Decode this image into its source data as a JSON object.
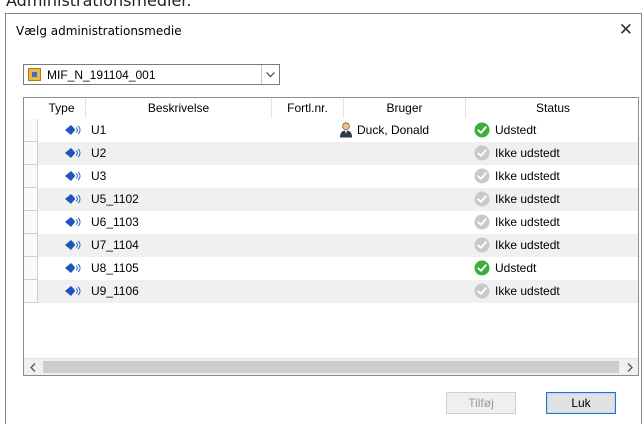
{
  "page_cut_title": "Administrationsmedier.",
  "dialog": {
    "title": "Vælg administrationsmedie",
    "close_label": "✕"
  },
  "combo": {
    "selected": "MIF_N_191104_001"
  },
  "table": {
    "headers": {
      "type": "Type",
      "desc": "Beskrivelse",
      "fortl": "Fortl.nr.",
      "bruger": "Bruger",
      "status": "Status"
    },
    "rows": [
      {
        "desc": "U1",
        "fortl": "",
        "bruger": "Duck, Donald",
        "status": "Udstedt"
      },
      {
        "desc": "U2",
        "fortl": "",
        "bruger": "",
        "status": "Ikke udstedt"
      },
      {
        "desc": "U3",
        "fortl": "",
        "bruger": "",
        "status": "Ikke udstedt"
      },
      {
        "desc": "U5_1102",
        "fortl": "",
        "bruger": "",
        "status": "Ikke udstedt"
      },
      {
        "desc": "U6_1103",
        "fortl": "",
        "bruger": "",
        "status": "Ikke udstedt"
      },
      {
        "desc": "U7_1104",
        "fortl": "",
        "bruger": "",
        "status": "Ikke udstedt"
      },
      {
        "desc": "U8_1105",
        "fortl": "",
        "bruger": "",
        "status": "Udstedt"
      },
      {
        "desc": "U9_1106",
        "fortl": "",
        "bruger": "",
        "status": "Ikke udstedt"
      }
    ]
  },
  "buttons": {
    "add_label": "Tilføj",
    "close_label": "Luk"
  },
  "icons": {
    "type": "rfid-tag-icon",
    "user": "user-icon",
    "issued": "check-green-icon",
    "not_issued": "check-gray-icon",
    "media": "media-card-icon"
  },
  "colors": {
    "issued": "#3cae3c",
    "not_issued": "#c9c9c9",
    "tag_blue": "#1b55c4",
    "focus_border": "#1e74cf"
  }
}
